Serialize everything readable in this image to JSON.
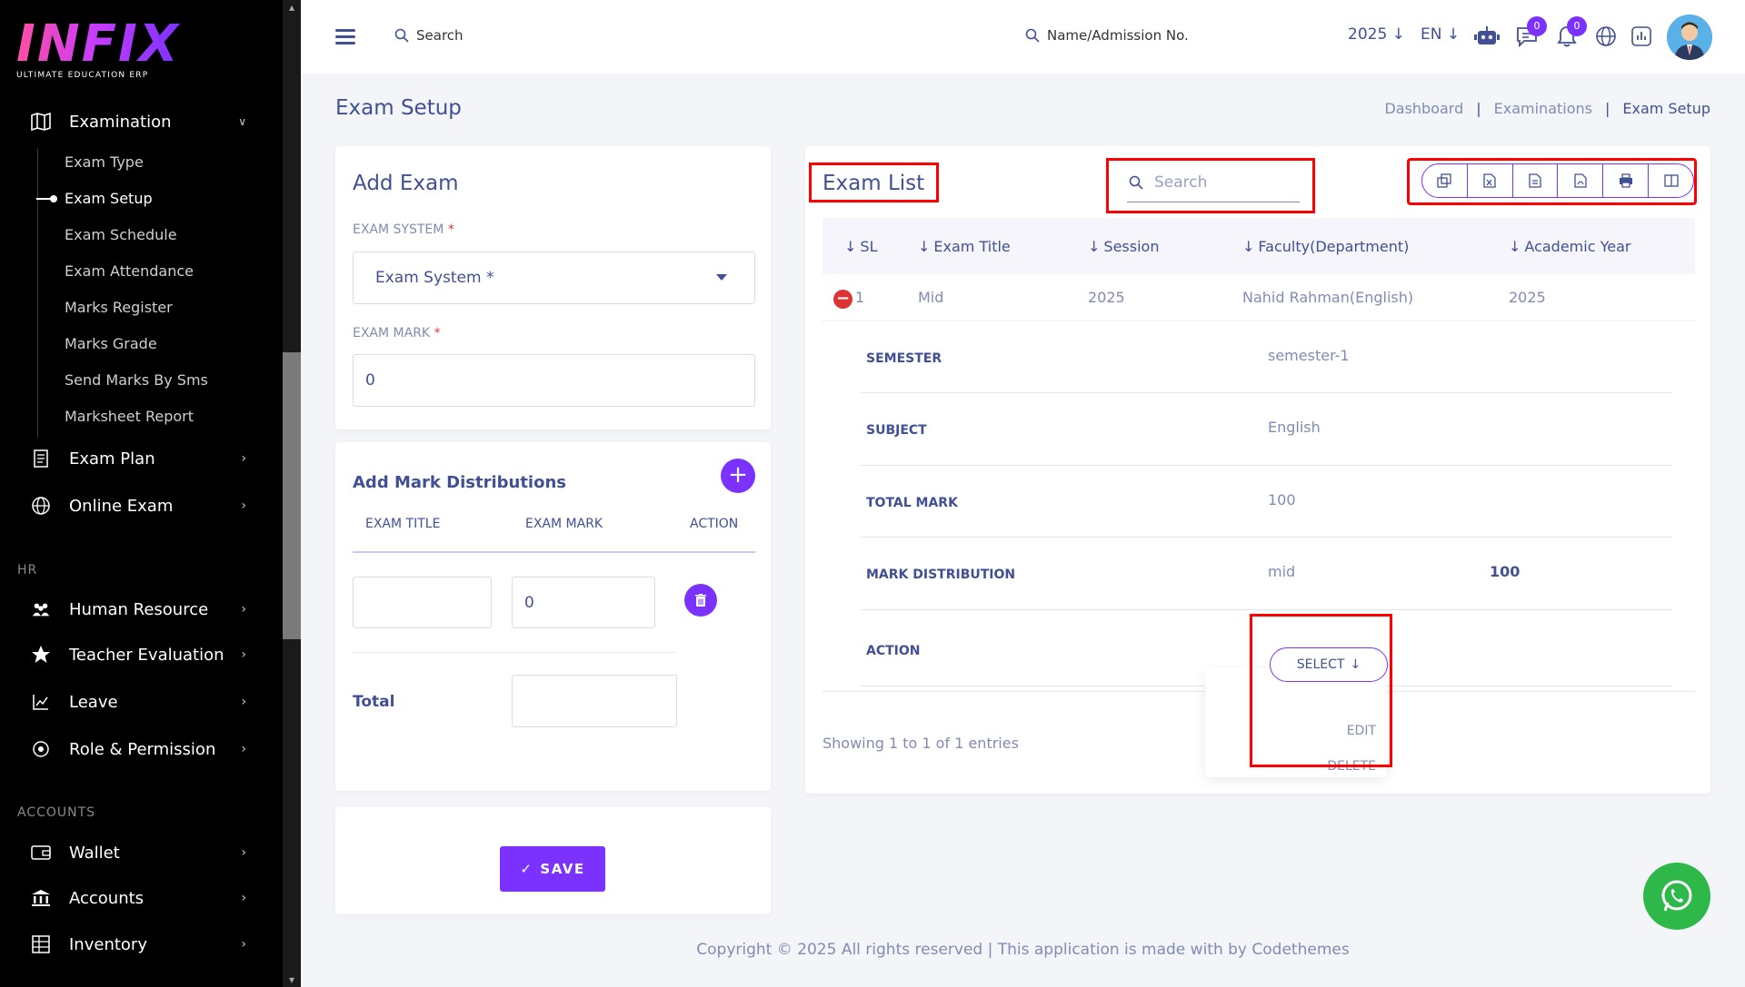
{
  "sidebar": {
    "logo": "INFIX",
    "logo_sub": "ULTIMATE EDUCATION ERP",
    "examination": "Examination",
    "sub_items": [
      "Exam Type",
      "Exam Setup",
      "Exam Schedule",
      "Exam Attendance",
      "Marks Register",
      "Marks Grade",
      "Send Marks By Sms",
      "Marksheet Report"
    ],
    "exam_plan": "Exam Plan",
    "online_exam": "Online Exam",
    "hr_label": "HR",
    "human_resource": "Human Resource",
    "teacher_evaluation": "Teacher Evaluation",
    "leave": "Leave",
    "role_permission": "Role & Permission",
    "accounts_label": "ACCOUNTS",
    "wallet": "Wallet",
    "accounts": "Accounts",
    "inventory": "Inventory"
  },
  "header": {
    "search": "Search",
    "admission_search": "Name/Admission No.",
    "year": "2025",
    "lang": "EN",
    "chat_count": "0",
    "notif_count": "0"
  },
  "page": {
    "title": "Exam Setup",
    "breadcrumb": [
      "Dashboard",
      "Examinations",
      "Exam Setup"
    ]
  },
  "add_exam": {
    "title": "Add Exam",
    "exam_system_label": "EXAM SYSTEM",
    "exam_system_placeholder": "Exam System *",
    "exam_mark_label": "EXAM MARK",
    "exam_mark_value": "0"
  },
  "mark_dist": {
    "title": "Add Mark Distributions",
    "col_title": "EXAM TITLE",
    "col_mark": "EXAM MARK",
    "col_action": "ACTION",
    "row_mark": "0",
    "total_label": "Total"
  },
  "save_label": "SAVE",
  "exam_list": {
    "title": "Exam List",
    "search_placeholder": "Search",
    "columns": [
      "SL",
      "Exam Title",
      "Session",
      "Faculty(Department)",
      "Academic Year"
    ],
    "row": {
      "sl": "1",
      "title": "Mid",
      "session": "2025",
      "faculty": "Nahid Rahman(English)",
      "year": "2025"
    },
    "details": {
      "semester_label": "SEMESTER",
      "semester": "semester-1",
      "subject_label": "SUBJECT",
      "subject": "English",
      "total_label": "TOTAL MARK",
      "total": "100",
      "dist_label": "MARK DISTRIBUTION",
      "dist_name": "mid",
      "dist_value": "100",
      "action_label": "ACTION"
    },
    "select_label": "SELECT",
    "menu": [
      "EDIT",
      "DELETE"
    ],
    "showing": "Showing 1 to 1 of 1 entries"
  },
  "footer": "Copyright © 2025 All rights reserved | This application is made with by Codethemes",
  "colors": {
    "accent": "#7c32ff",
    "text": "#415094",
    "muted": "#828bb2",
    "highlight": "#ff0000"
  }
}
